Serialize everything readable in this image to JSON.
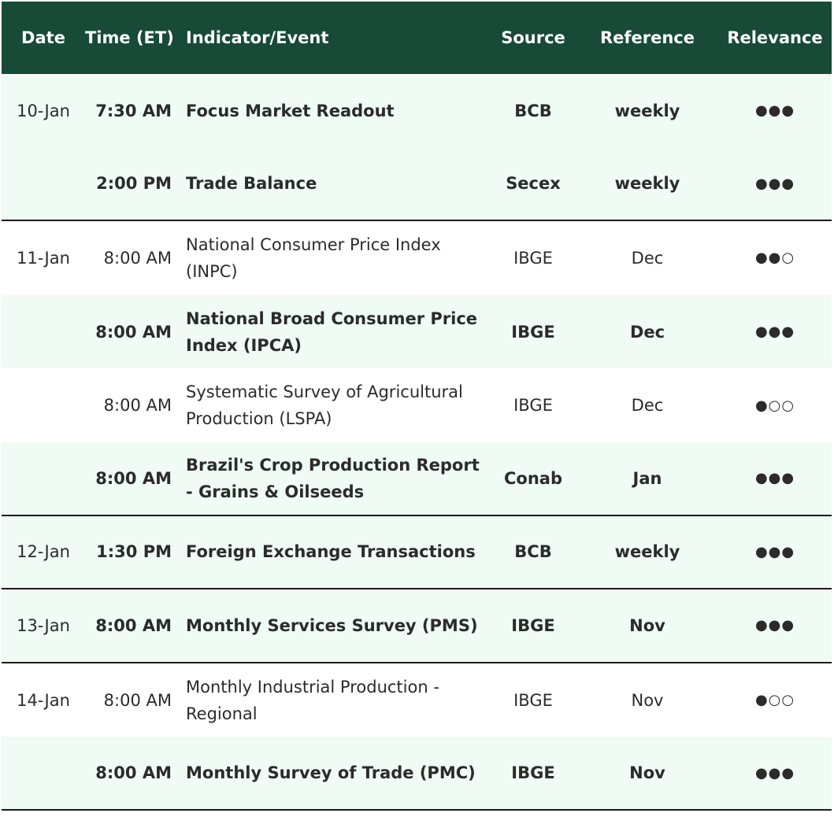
{
  "header": {
    "date": "Date",
    "time": "Time (ET)",
    "event": "Indicator/Event",
    "source": "Source",
    "reference": "Reference",
    "relevance": "Relevance"
  },
  "rows": [
    {
      "date": "10-Jan",
      "time": "7:30 AM",
      "event": "Focus Market Readout",
      "source": "BCB",
      "reference": "weekly",
      "relevance": "●●●"
    },
    {
      "date": "",
      "time": "2:00 PM",
      "event": "Trade Balance",
      "source": "Secex",
      "reference": "weekly",
      "relevance": "●●●"
    },
    {
      "date": "11-Jan",
      "time": "8:00 AM",
      "event": "National Consumer Price Index (INPC)",
      "source": "IBGE",
      "reference": "Dec",
      "relevance": "●●○"
    },
    {
      "date": "",
      "time": "8:00 AM",
      "event": "National Broad Consumer Price Index (IPCA)",
      "source": "IBGE",
      "reference": "Dec",
      "relevance": "●●●"
    },
    {
      "date": "",
      "time": "8:00 AM",
      "event": "Systematic Survey of Agricultural Production (LSPA)",
      "source": "IBGE",
      "reference": "Dec",
      "relevance": "●○○"
    },
    {
      "date": "",
      "time": "8:00 AM",
      "event": "Brazil's Crop Production Report - Grains & Oilseeds",
      "source": "Conab",
      "reference": "Jan",
      "relevance": "●●●"
    },
    {
      "date": "12-Jan",
      "time": "1:30 PM",
      "event": "Foreign Exchange Transactions",
      "source": "BCB",
      "reference": "weekly",
      "relevance": "●●●"
    },
    {
      "date": "13-Jan",
      "time": "8:00 AM",
      "event": "Monthly Services Survey (PMS)",
      "source": "IBGE",
      "reference": "Nov",
      "relevance": "●●●"
    },
    {
      "date": "14-Jan",
      "time": "8:00 AM",
      "event": "Monthly Industrial Production - Regional",
      "source": "IBGE",
      "reference": "Nov",
      "relevance": "●○○"
    },
    {
      "date": "",
      "time": "8:00 AM",
      "event": "Monthly Survey of Trade (PMC)",
      "source": "IBGE",
      "reference": "Nov",
      "relevance": "●●●"
    }
  ],
  "colors": {
    "header_bg": "#174a37",
    "row_shade": "#effbf4",
    "divider": "#1b1b1b"
  }
}
